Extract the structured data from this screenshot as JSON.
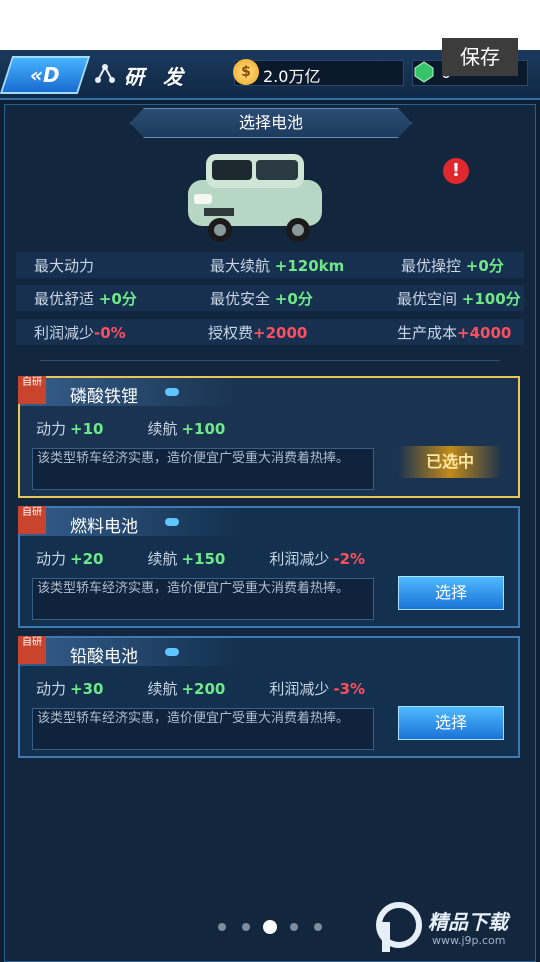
{
  "header": {
    "back_label": "",
    "section_title": "研 发",
    "coins": "2.0万亿",
    "gems": "0",
    "save_label": "保存"
  },
  "panel": {
    "title": "选择电池"
  },
  "stats": {
    "row1": [
      {
        "label": "最大动力",
        "value": ""
      },
      {
        "label": "最大续航",
        "value": "+120km"
      },
      {
        "label": "最优操控",
        "value": "+0分"
      }
    ],
    "row2": [
      {
        "label": "最优舒适",
        "value": "+0分"
      },
      {
        "label": "最优安全",
        "value": "+0分"
      },
      {
        "label": "最优空间",
        "value": "+100分"
      }
    ],
    "row3": [
      {
        "label": "利润减少",
        "value": "-0%"
      },
      {
        "label": "授权费",
        "value": "+2000"
      },
      {
        "label": "生产成本",
        "value": "+4000"
      }
    ]
  },
  "batteries": [
    {
      "tag": "自研",
      "name": "磷酸铁锂",
      "power_label": "动力",
      "power": "+10",
      "range_label": "续航",
      "range": "+100",
      "profit_label": "",
      "profit": "",
      "desc": "该类型轿车经济实惠，造价便宜广受重大消费着热捧。",
      "button": "已选中",
      "selected": true
    },
    {
      "tag": "自研",
      "name": "燃料电池",
      "power_label": "动力",
      "power": "+20",
      "range_label": "续航",
      "range": "+150",
      "profit_label": "利润减少",
      "profit": "-2%",
      "desc": "该类型轿车经济实惠，造价便宜广受重大消费着热捧。",
      "button": "选择",
      "selected": false
    },
    {
      "tag": "自研",
      "name": "铅酸电池",
      "power_label": "动力",
      "power": "+30",
      "range_label": "续航",
      "range": "+200",
      "profit_label": "利润减少",
      "profit": "-3%",
      "desc": "该类型轿车经济实惠，造价便宜广受重大消费着热捧。",
      "button": "选择",
      "selected": false
    }
  ],
  "pager": {
    "count": 5,
    "active": 2
  },
  "watermark": {
    "text": "精品下载",
    "url": "www.j9p.com"
  },
  "colors": {
    "positive": "#6fe88a",
    "negative": "#ff4f5f",
    "selected_border": "#e8c658"
  }
}
